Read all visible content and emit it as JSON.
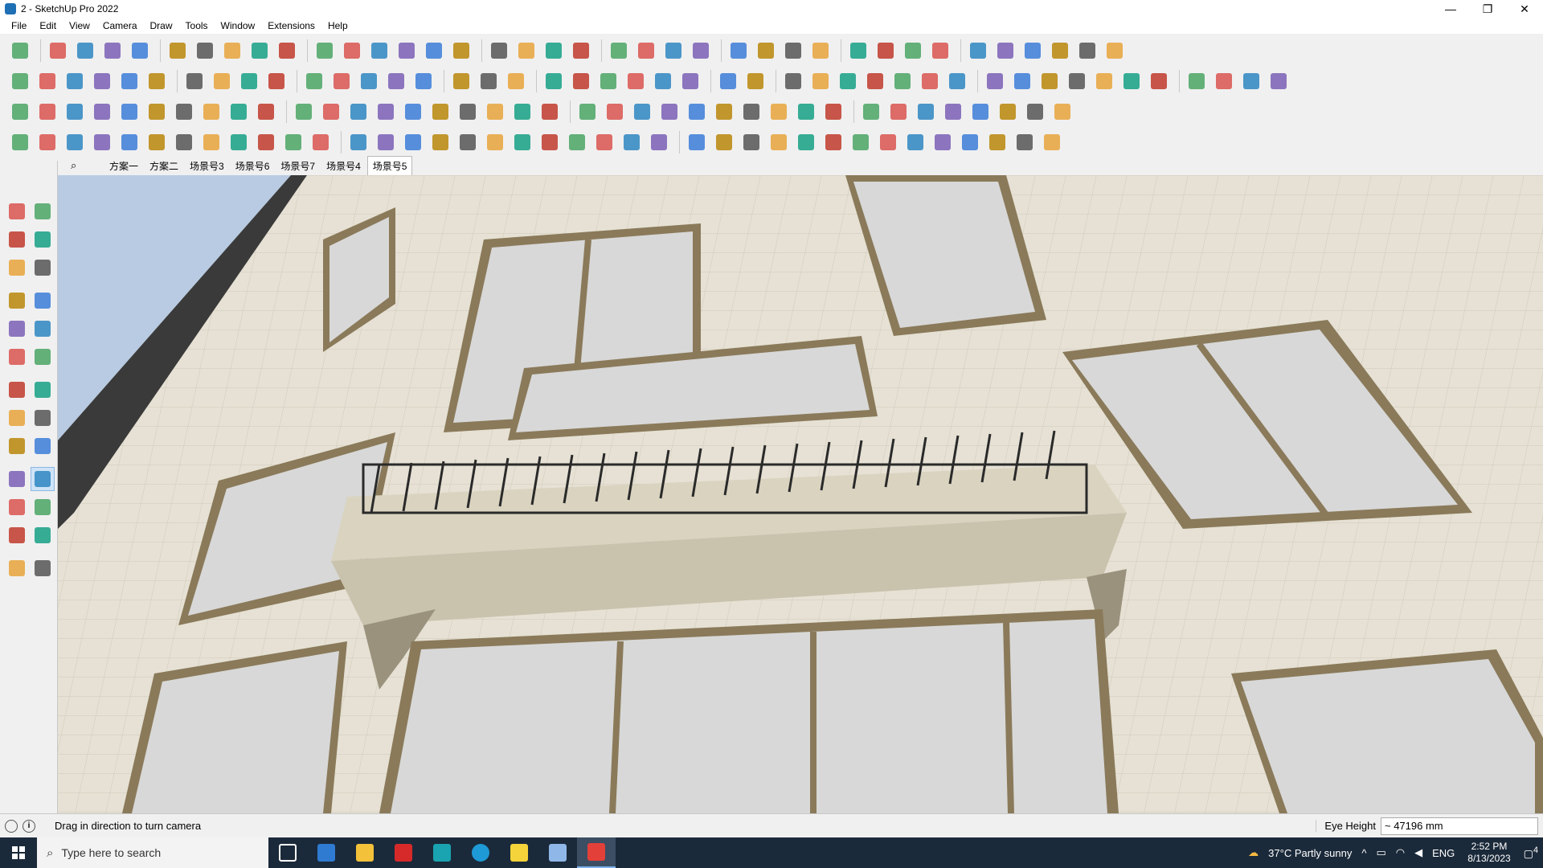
{
  "window": {
    "title": "2 - SketchUp Pro 2022",
    "controls": [
      "—",
      "❐",
      "✕"
    ]
  },
  "menu": [
    "File",
    "Edit",
    "View",
    "Camera",
    "Draw",
    "Tools",
    "Window",
    "Extensions",
    "Help"
  ],
  "scene_tabs": {
    "search_glyph": "⌕",
    "tabs": [
      "方案一",
      "方案二",
      "场景号3",
      "场景号6",
      "场景号7",
      "场景号4",
      "场景号5"
    ],
    "active": "场景号5"
  },
  "status": {
    "hint": "Drag in direction to turn camera",
    "vcb_label": "Eye Height",
    "vcb_value": "~ 47196 mm"
  },
  "taskbar": {
    "search_placeholder": "Type here to search",
    "weather": "37°C  Partly sunny",
    "language": "ENG",
    "time": "2:52 PM",
    "date": "8/13/2023",
    "notification_count": "4"
  },
  "colors": {
    "facade": "#e6e1d4",
    "tile_line": "#cfc9b9",
    "frame": "#8a7a5a",
    "glass": "#d8d8d8",
    "sky": "#b8cbe2",
    "railing": "#2a2a2a"
  }
}
